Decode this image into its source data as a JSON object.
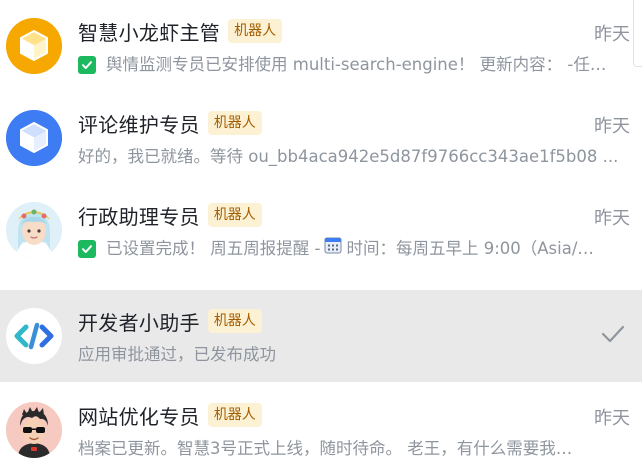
{
  "chats": [
    {
      "name": "智慧小龙虾主管",
      "badge": "机器人",
      "time": "昨天",
      "preview": "舆情监测专员已安排使用 multi-search-engine！ 更新内容： -任…",
      "has_check": true,
      "avatar_icon": "yellow-cube-icon"
    },
    {
      "name": "评论维护专员",
      "badge": "机器人",
      "time": "昨天",
      "preview": "好的，我已就绪。等待 ou_bb4aca942e5d87f9766cc343ae1f5b08 ...",
      "has_check": false,
      "avatar_icon": "blue-cube-icon"
    },
    {
      "name": "行政助理专员",
      "badge": "机器人",
      "time": "昨天",
      "preview_before": "已设置完成！ 周五周报提醒 -",
      "preview_after": "时间：每周五早上 9:00（Asia/…",
      "has_check": true,
      "avatar_icon": "girl-avatar-icon"
    },
    {
      "name": "开发者小助手",
      "badge": "机器人",
      "preview": "应用审批通过，已发布成功",
      "selected": true,
      "avatar_icon": "code-brackets-icon"
    },
    {
      "name": "网站优化专员",
      "badge": "机器人",
      "time": "昨天",
      "preview": "档案已更新。智慧3号正式上线，随时待命。 老王，有什么需要我…",
      "has_check": false,
      "avatar_icon": "boy-sunglasses-avatar-icon"
    }
  ],
  "colors": {
    "badge_bg": "#fdf1d3",
    "badge_text": "#a35d00",
    "check_green": "#1db95f",
    "selected_bg": "#e9e9e9",
    "muted_text": "#8f959e"
  }
}
